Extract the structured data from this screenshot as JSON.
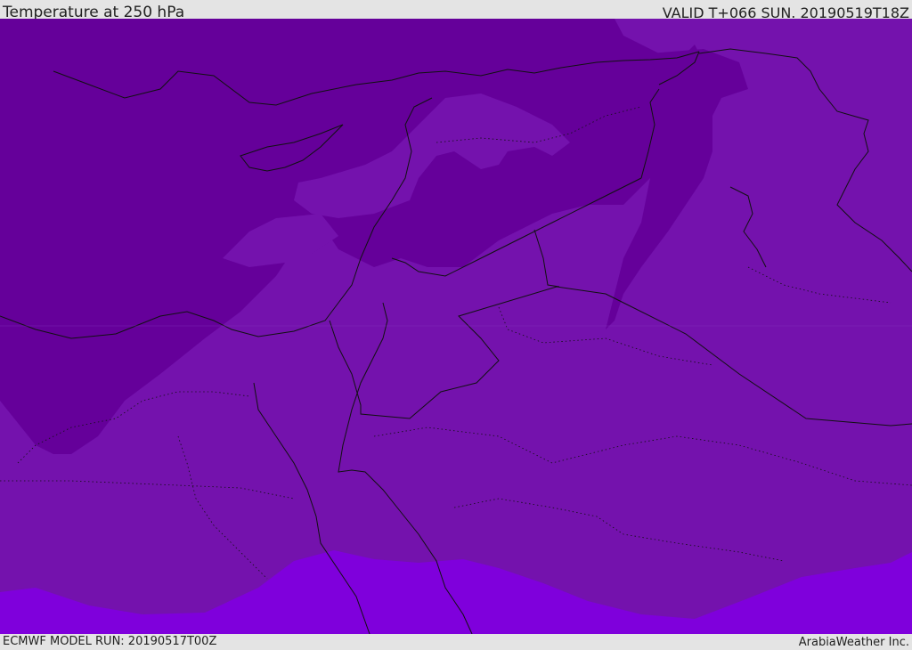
{
  "header": {
    "title": "Temperature at 250 hPa",
    "valid": "VALID T+066 SUN. 20190519T18Z"
  },
  "footer": {
    "model_run": "ECMWF MODEL RUN: 20190517T00Z",
    "credit": "ArabiaWeather Inc."
  },
  "colors": {
    "coldest": "#65009a",
    "cold": "#7412ad",
    "mid": "#7a12b4",
    "warm": "#7f00dc",
    "border": "#111111"
  }
}
